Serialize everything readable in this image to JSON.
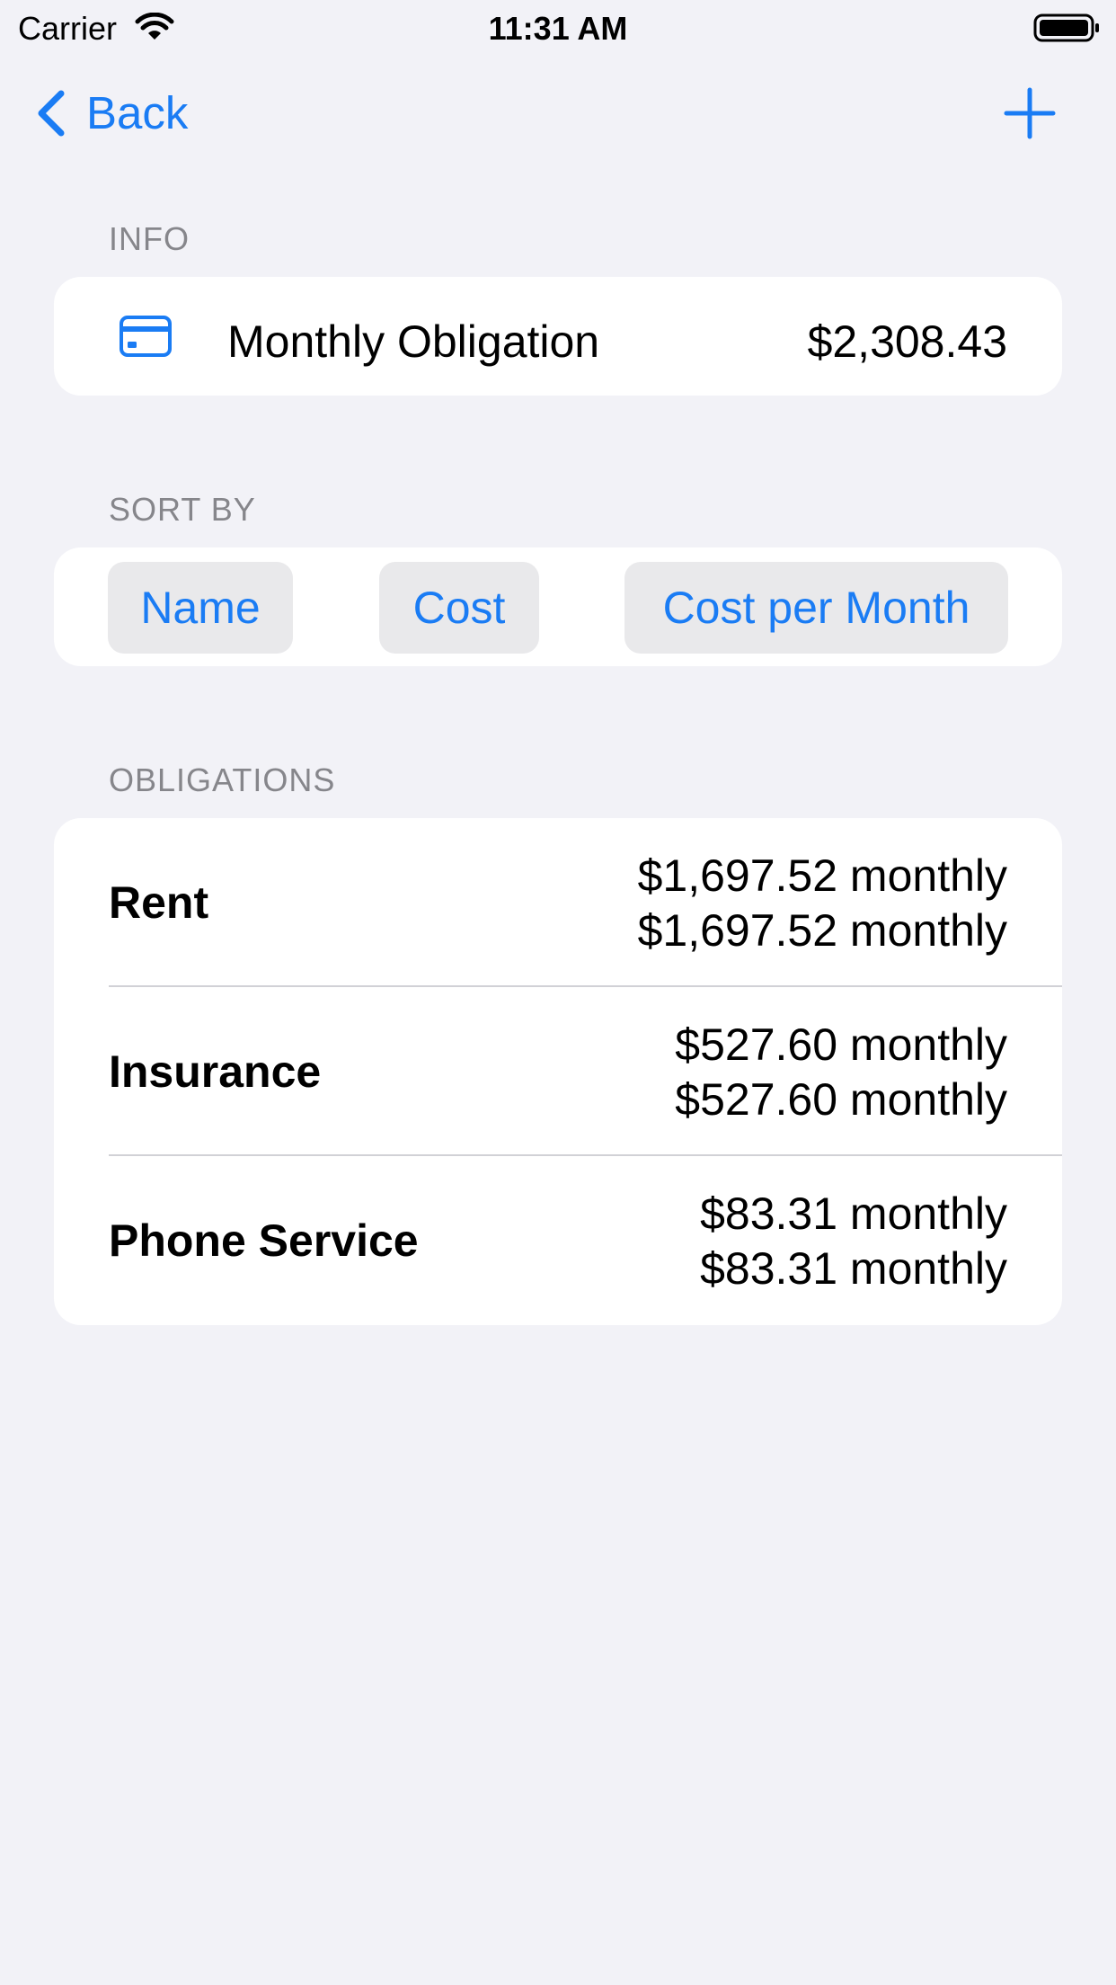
{
  "status_bar": {
    "carrier": "Carrier",
    "time": "11:31 AM"
  },
  "nav": {
    "back_label": "Back",
    "add_icon": "plus-icon",
    "back_icon": "chevron-left-icon"
  },
  "info": {
    "header": "INFO",
    "icon": "credit-card-icon",
    "title": "Monthly Obligation",
    "value": "$2,308.43"
  },
  "sort": {
    "header": "SORT BY",
    "options": [
      "Name",
      "Cost",
      "Cost per Month"
    ]
  },
  "obligations": {
    "header": "OBLIGATIONS",
    "items": [
      {
        "name": "Rent",
        "cost": "$1,697.52 monthly",
        "cost_per_month": "$1,697.52 monthly"
      },
      {
        "name": "Insurance",
        "cost": "$527.60 monthly",
        "cost_per_month": "$527.60 monthly"
      },
      {
        "name": "Phone Service",
        "cost": "$83.31 monthly",
        "cost_per_month": "$83.31 monthly"
      }
    ]
  },
  "colors": {
    "accent": "#1A7CF4",
    "background": "#F2F2F7",
    "card": "#FFFFFF",
    "secondary_text": "#86868B",
    "button_fill": "#E9E9EB"
  }
}
